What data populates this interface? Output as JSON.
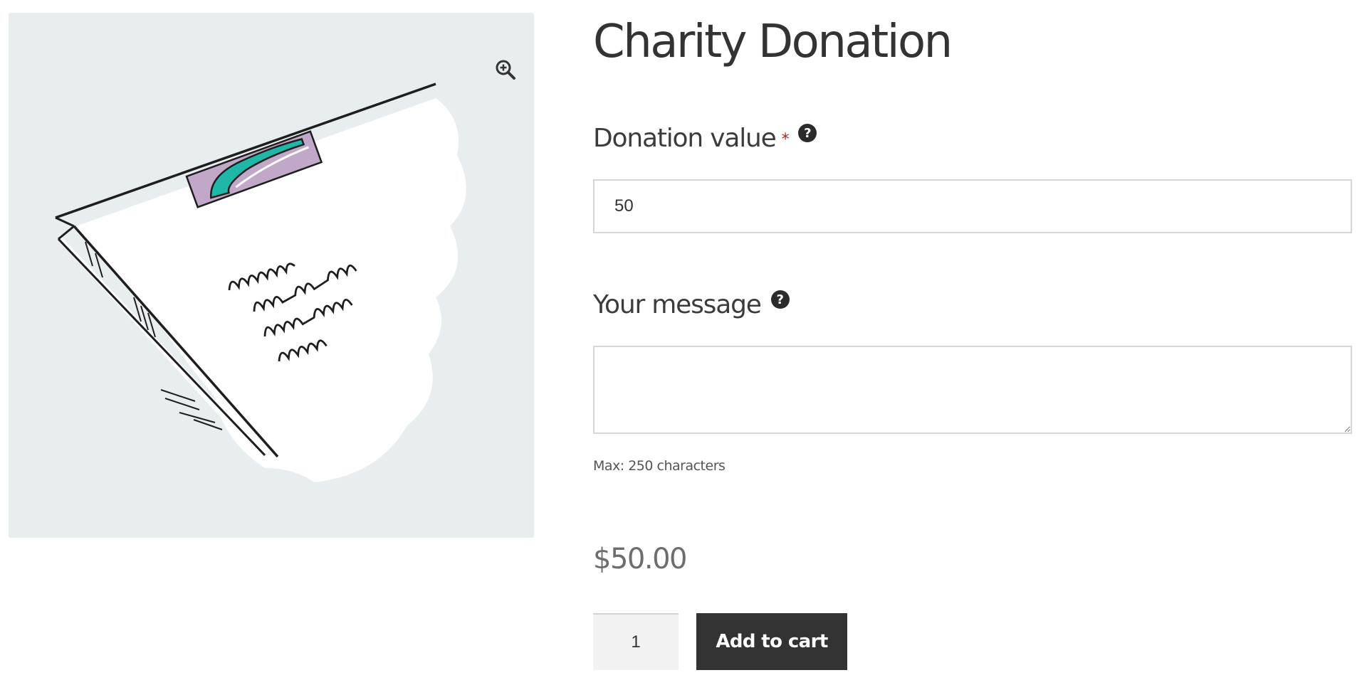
{
  "product": {
    "title": "Charity Donation",
    "price": "$50.00"
  },
  "gallery": {
    "zoom_icon": "zoom-in-magnifier-icon",
    "illustration": "hand-drawn-envelope-with-stamp-and-handwriting",
    "colors": {
      "background": "#e8edf0",
      "stamp_teal": "#1fb8a8",
      "stamp_purple": "#c1a8c9"
    }
  },
  "form": {
    "donation": {
      "label": "Donation value",
      "required_mark": "*",
      "help_icon": "?",
      "value": "50"
    },
    "message": {
      "label": "Your message",
      "help_icon": "?",
      "value": "",
      "hint": "Max: 250 characters"
    }
  },
  "cart": {
    "quantity": "1",
    "add_button_label": "Add to cart",
    "button_color": "#333333"
  }
}
